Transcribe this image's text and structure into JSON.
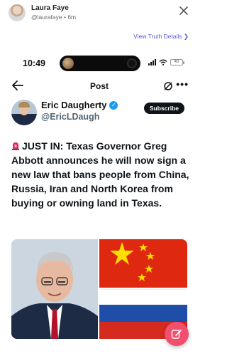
{
  "outer_post": {
    "name": "Laura Faye",
    "handle": "@laurafaye",
    "time": "6m",
    "view_details": "View Truth Details ❯"
  },
  "screenshot": {
    "status_bar": {
      "time": "10:49",
      "battery": "40"
    },
    "nav": {
      "title": "Post"
    },
    "author": {
      "name": "Eric Daugherty",
      "handle": "@EricLDaugh",
      "subscribe_label": "Subscribe"
    },
    "post_text": "JUST IN: Texas Governor Greg Abbott announces he will now sign a new law that bans people from China, Russia, Iran and North Korea from buying or owning land in Texas.",
    "media": {
      "right_flags": [
        "China",
        "Russia"
      ]
    }
  },
  "colors": {
    "accent_link": "#5a5ad6",
    "verified": "#1d9bf0",
    "fab": "#f0506e",
    "subscribe_bg": "#0f1419"
  },
  "icons": [
    "close-icon",
    "back-arrow-icon",
    "grok-icon",
    "more-icon",
    "verified-icon",
    "siren-icon",
    "compose-icon",
    "wifi-icon",
    "signal-icon",
    "battery-icon"
  ]
}
